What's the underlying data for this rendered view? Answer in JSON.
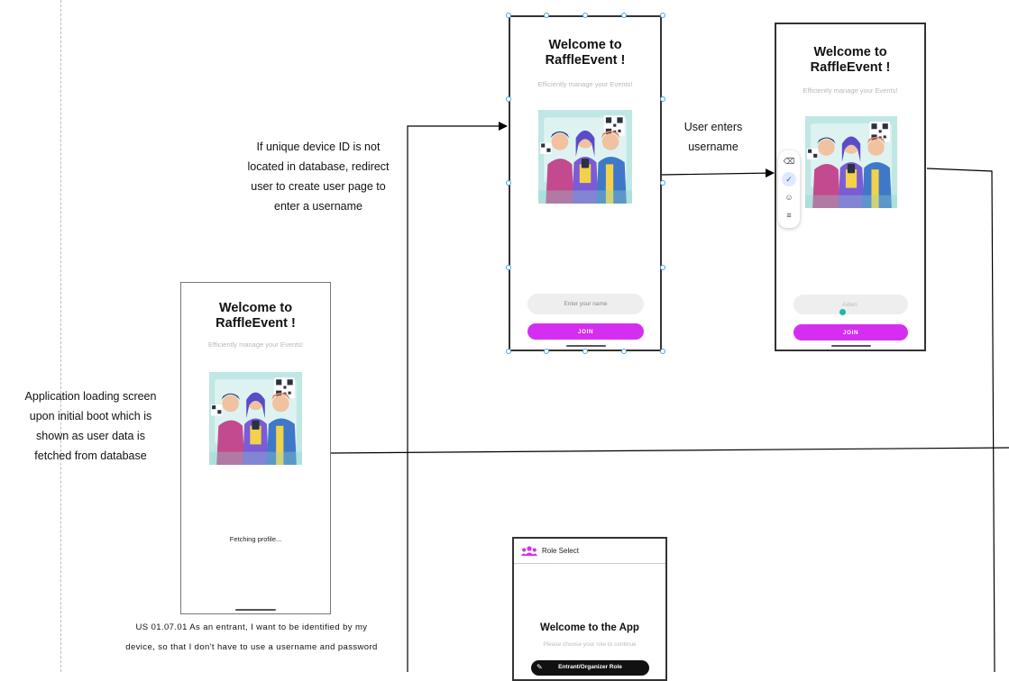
{
  "notes": {
    "loading": [
      "Application loading screen",
      "upon initial boot which is",
      "shown as user data is",
      "fetched from database"
    ],
    "redirect": [
      "If unique device ID is not",
      "located in database, redirect",
      "user to create user page to",
      "enter a username"
    ],
    "user_enters": [
      "User enters",
      "username"
    ],
    "user_story": [
      "US 01.07.01 As an entrant, I want to be identified by my",
      "device, so that I don't have to use a username and password"
    ]
  },
  "screens": {
    "loading": {
      "title_line1": "Welcome to",
      "title_line2": "RaffleEvent !",
      "subtitle": "Efficiently manage your Events!",
      "status": "Fetching profile..."
    },
    "create_user": {
      "title_line1": "Welcome to",
      "title_line2": "RaffleEvent !",
      "subtitle": "Efficiently manage your Events!",
      "name_placeholder": "Enter your name",
      "join_label": "JOIN"
    },
    "entered": {
      "title_line1": "Welcome to",
      "title_line2": "RaffleEvent !",
      "subtitle": "Efficiently manage your Events!",
      "name_value": "Aiden",
      "join_label": "JOIN"
    },
    "role_select": {
      "appbar_title": "Role Select",
      "heading": "Welcome to the App",
      "subtitle": "Please choose your role to continue",
      "role_button": "Entrant/Organizer Role"
    }
  },
  "icons": {
    "keyboard_toolbar": [
      "backspace-icon",
      "check-icon",
      "emoji-icon",
      "menu-icon"
    ],
    "appbar": "people-group-icon"
  },
  "colors": {
    "accent": "#d52ef1",
    "selection": "#4aa3df",
    "cursor": "#1fb7ae"
  }
}
